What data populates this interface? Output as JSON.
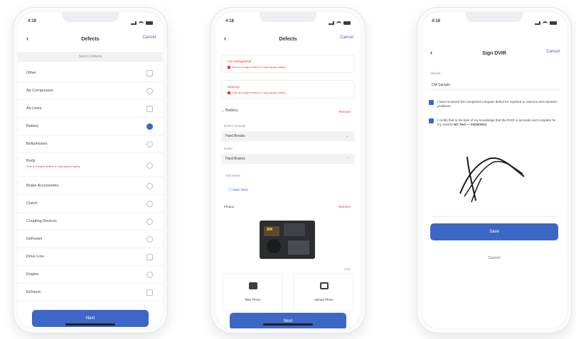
{
  "phone1": {
    "status_time": "4:18",
    "nav": {
      "title": "Defects",
      "back_icon": "chevron-left-icon",
      "cancel": "Cancel"
    },
    "section": "Select Defects",
    "items": [
      {
        "label": "Other",
        "checked": false,
        "shape": "square"
      },
      {
        "label": "Air Compressor",
        "checked": false,
        "shape": "circle"
      },
      {
        "label": "Air Lines",
        "checked": false,
        "shape": "square"
      },
      {
        "label": "Battery",
        "checked": true,
        "shape": "circle"
      },
      {
        "label": "Belts/Hoses",
        "checked": false,
        "shape": "circle"
      },
      {
        "label": "Body",
        "checked": false,
        "shape": "circle",
        "warning": "This is a major defect; it may impact safety"
      },
      {
        "label": "Brake Accessories",
        "checked": false,
        "shape": "circle"
      },
      {
        "label": "Clutch",
        "checked": false,
        "shape": "circle"
      },
      {
        "label": "Coupling Devices",
        "checked": false,
        "shape": "circle"
      },
      {
        "label": "Defroster",
        "checked": false,
        "shape": "circle"
      },
      {
        "label": "Drive Line",
        "checked": false,
        "shape": "square"
      },
      {
        "label": "Engine",
        "checked": false,
        "shape": "circle"
      },
      {
        "label": "Exhaust",
        "checked": false,
        "shape": "square"
      }
    ],
    "next_button": "Next"
  },
  "phone2": {
    "status_time": "4:18",
    "nav": {
      "title": "Defects",
      "back_icon": "chevron-left-icon",
      "cancel": "Cancel"
    },
    "alert1": {
      "title": "Fire Extinguisher",
      "subtitle": "This is a major defect; it may impact safety"
    },
    "alert2": {
      "title": "Steering",
      "subtitle": "This is a major defect; it may impact safety"
    },
    "battery": {
      "label": "Battery",
      "action": "Remove"
    },
    "defect_severity_label": "Defect Severity",
    "defect_severity_value": "Hard Breaks",
    "notes_label": "Notes",
    "notes_value": "Hard Brakes",
    "notes_placeholder": "Add Notes",
    "mark_fixed": "Mark fixed",
    "photos_label": "Photos",
    "photos_action": "Remove",
    "photo_count": "1/10",
    "take_photo": "Take Photo",
    "upload_photo": "Upload Photo",
    "next_button": "Next"
  },
  "phone3": {
    "status_time": "4:18",
    "nav": {
      "title": "Sign DVIR",
      "back_icon": "chevron-left-icon",
      "cancel": "Cancel"
    },
    "section_label": "Vehicle",
    "vehicle_value": "DM Sample",
    "cert1": "I have reviewed the completed company defect for repaired or reasons and reported problems.",
    "cert2": "I certify that to the best of my knowledge that the DVIR is accurate and complete for my Vehicle",
    "cert2_bold": "NO Test — 03/25/2021",
    "save_button": "Save",
    "cancel_button": "Cancel"
  }
}
